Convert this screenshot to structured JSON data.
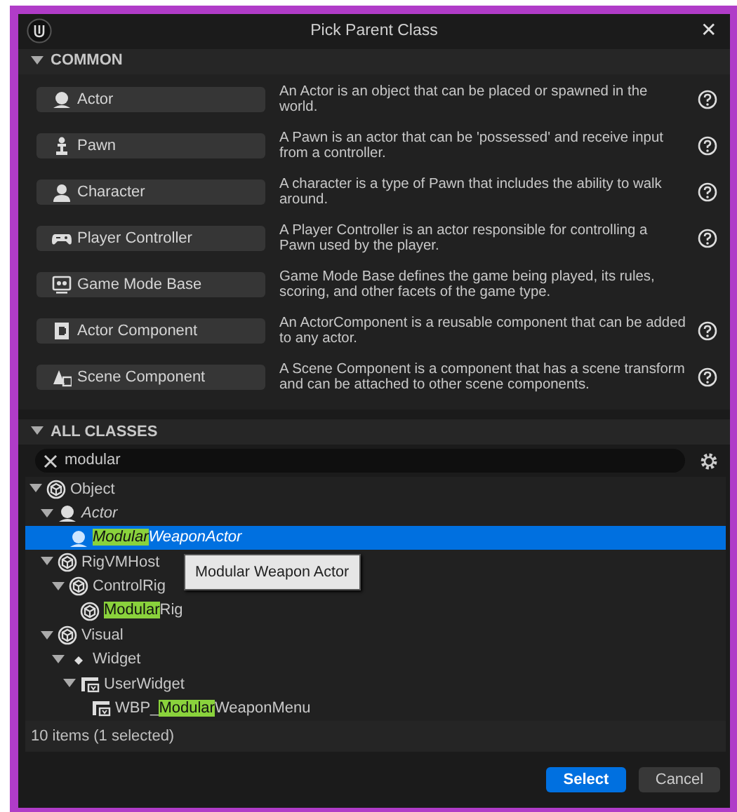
{
  "window": {
    "title": "Pick Parent Class",
    "close": "✕"
  },
  "common": {
    "title": "COMMON",
    "expanded": true,
    "items": [
      {
        "label": "Actor",
        "kind": "actor",
        "description": "An Actor is an object that can be placed or spawned in the world.",
        "help": true
      },
      {
        "label": "Pawn",
        "kind": "pawn",
        "description": "A Pawn is an actor that can be 'possessed' and receive input from a controller.",
        "help": true
      },
      {
        "label": "Character",
        "kind": "character",
        "description": "A character is a type of Pawn that includes the ability to walk around.",
        "help": true
      },
      {
        "label": "Player Controller",
        "kind": "controller",
        "description": "A Player Controller is an actor responsible for controlling a Pawn used by the player.",
        "help": true
      },
      {
        "label": "Game Mode Base",
        "kind": "gamemode",
        "description": "Game Mode Base defines the game being played, its rules, scoring, and other facets of the game type.",
        "help": false
      },
      {
        "label": "Actor Component",
        "kind": "component",
        "description": "An ActorComponent is a reusable component that can be added to any actor.",
        "help": true
      },
      {
        "label": "Scene Component",
        "kind": "scene",
        "description": "A Scene Component is a component that has a scene transform and can be attached to other scene components.",
        "help": true
      }
    ]
  },
  "all_classes": {
    "title": "ALL CLASSES",
    "expanded": true,
    "search": {
      "value": "modular"
    },
    "tree": [
      {
        "parts": [
          {
            "text": "Object",
            "highlight": false
          }
        ],
        "kind": "object",
        "italic": false,
        "selected": false,
        "expanded": true,
        "children": [
          {
            "parts": [
              {
                "text": "Actor",
                "highlight": false
              }
            ],
            "kind": "actor",
            "italic": true,
            "selected": false,
            "expanded": true,
            "children": [
              {
                "parts": [
                  {
                    "text": "Modular",
                    "highlight": true
                  },
                  {
                    "text": "WeaponActor",
                    "highlight": false
                  }
                ],
                "kind": "actor",
                "italic": true,
                "selected": true,
                "tooltip": "Modular Weapon Actor"
              }
            ]
          },
          {
            "parts": [
              {
                "text": "RigVMHost",
                "highlight": false
              }
            ],
            "kind": "object",
            "italic": false,
            "selected": false,
            "expanded": true,
            "children": [
              {
                "parts": [
                  {
                    "text": "ControlRig",
                    "highlight": false
                  }
                ],
                "kind": "object",
                "italic": false,
                "selected": false,
                "expanded": true,
                "children": [
                  {
                    "parts": [
                      {
                        "text": "Modular",
                        "highlight": true
                      },
                      {
                        "text": "Rig",
                        "highlight": false
                      }
                    ],
                    "kind": "object",
                    "italic": false,
                    "selected": false
                  }
                ]
              }
            ]
          },
          {
            "parts": [
              {
                "text": "Visual",
                "highlight": false
              }
            ],
            "kind": "object",
            "italic": false,
            "selected": false,
            "expanded": true,
            "children": [
              {
                "parts": [
                  {
                    "text": "Widget",
                    "highlight": false
                  }
                ],
                "kind": "dot",
                "italic": false,
                "selected": false,
                "expanded": true,
                "children": [
                  {
                    "parts": [
                      {
                        "text": "UserWidget",
                        "highlight": false
                      }
                    ],
                    "kind": "userwidget",
                    "italic": false,
                    "selected": false,
                    "expanded": true,
                    "children": [
                      {
                        "parts": [
                          {
                            "text": "WBP_",
                            "highlight": false
                          },
                          {
                            "text": "Modular",
                            "highlight": true
                          },
                          {
                            "text": "WeaponMenu",
                            "highlight": false
                          }
                        ],
                        "kind": "userwidget",
                        "italic": false,
                        "selected": false
                      }
                    ]
                  }
                ]
              }
            ]
          }
        ]
      }
    ],
    "status": "10 items (1 selected)"
  },
  "buttons": [
    {
      "label": "Select",
      "kind": "primary"
    },
    {
      "label": "Cancel",
      "kind": "secondary"
    }
  ]
}
